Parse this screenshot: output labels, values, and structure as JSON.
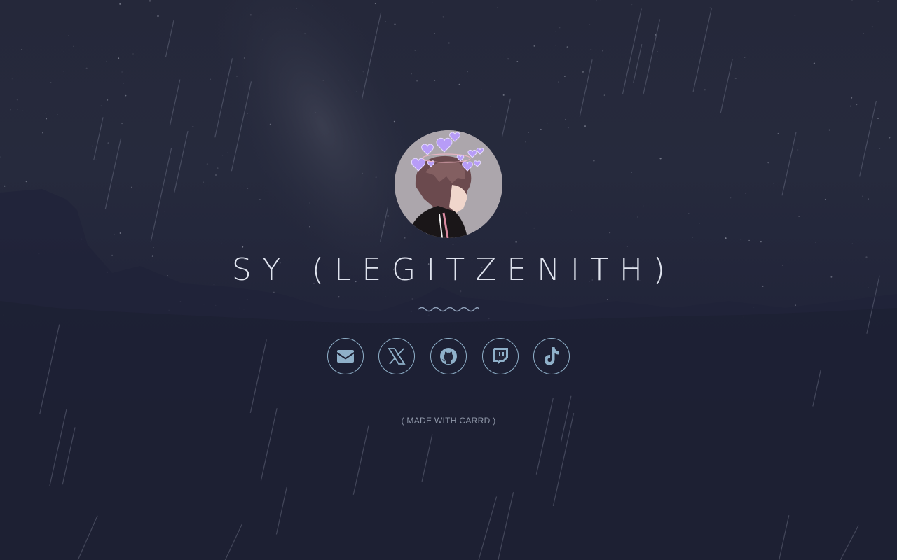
{
  "profile": {
    "name": "SY (LEGITZENITH)",
    "avatar_description": "avatar-image"
  },
  "socials": [
    {
      "name": "email",
      "icon": "envelope-icon"
    },
    {
      "name": "x",
      "icon": "x-logo-icon"
    },
    {
      "name": "github",
      "icon": "github-icon"
    },
    {
      "name": "twitch",
      "icon": "twitch-icon"
    },
    {
      "name": "tiktok",
      "icon": "tiktok-icon"
    }
  ],
  "footer": {
    "label": "( MADE WITH CARRD )"
  },
  "colors": {
    "background": "#1f2133",
    "accent": "#8fb0c9",
    "title": "#dfe3ee",
    "footer": "#8f97a8"
  }
}
